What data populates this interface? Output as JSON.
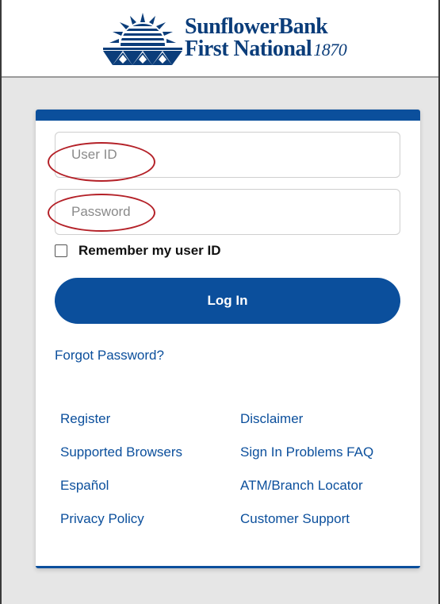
{
  "brand": {
    "name_line1": "SunflowerBank",
    "name_line2": "First National",
    "year": "1870",
    "colors": {
      "primary": "#0b4f9c",
      "dark": "#0b3d7a",
      "annotation": "#b42128"
    }
  },
  "login": {
    "user_id_placeholder": "User ID",
    "user_id_value": "",
    "password_placeholder": "Password",
    "password_value": "",
    "remember_label": "Remember my user ID",
    "remember_checked": false,
    "login_button": "Log In",
    "forgot_password": "Forgot Password?"
  },
  "links": {
    "rows": [
      {
        "left": "Register",
        "right": "Disclaimer"
      },
      {
        "left": "Supported Browsers",
        "right": "Sign In Problems FAQ"
      },
      {
        "left": "Español",
        "right": "ATM/Branch Locator"
      },
      {
        "left": "Privacy Policy",
        "right": "Customer Support"
      }
    ]
  },
  "icons": {
    "logo": "sunflower-bank-logo-icon",
    "checkbox": "checkbox-icon"
  }
}
